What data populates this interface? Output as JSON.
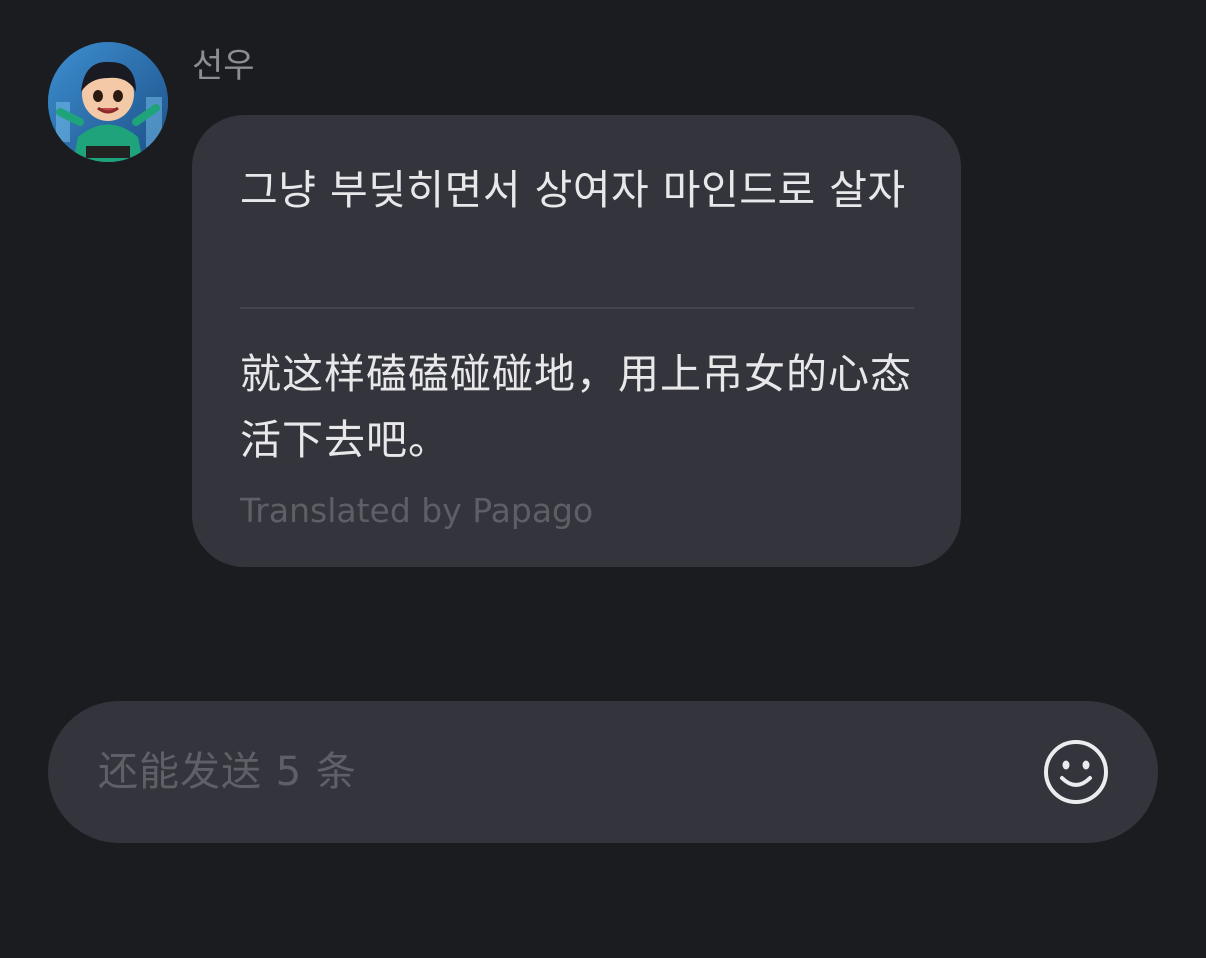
{
  "message": {
    "sender_name": "선우",
    "original_text": "그냥 부딪히면서 상여자 마인드로 살자",
    "translated_text": "就这样磕磕碰碰地，用上吊女的心态活下去吧。",
    "translated_by": "Translated by Papago"
  },
  "composer": {
    "placeholder": "还能发送 5 条",
    "emoji_icon": "smiley-icon"
  },
  "colors": {
    "background": "#1b1c20",
    "bubble": "#34353c"
  }
}
